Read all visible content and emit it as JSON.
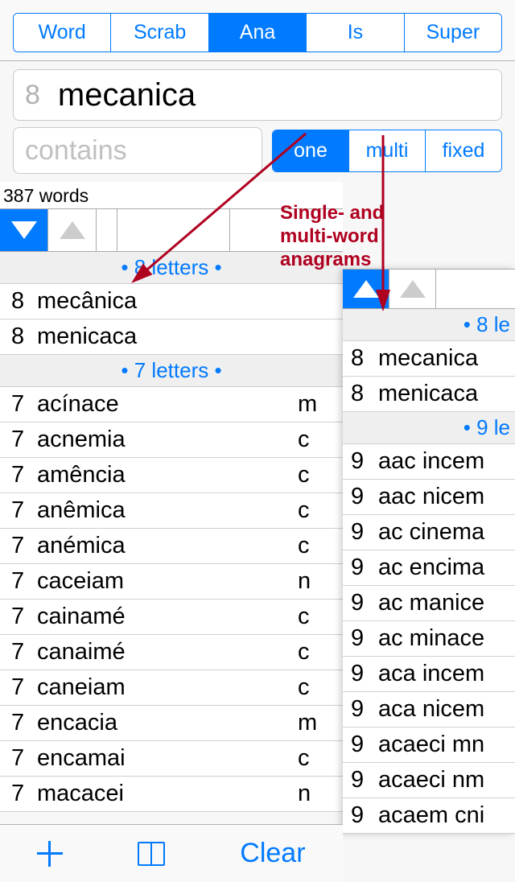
{
  "tabs": [
    "Word",
    "Scrab",
    "Ana",
    "Is",
    "Super"
  ],
  "tabs_active": 2,
  "search": {
    "count": "8",
    "term": "mecanica"
  },
  "contains_placeholder": "contains",
  "modes": [
    "one",
    "multi",
    "fixed"
  ],
  "modes_active": 0,
  "result_count_label": "387 words",
  "left": {
    "sections": [
      {
        "title": "• 8 letters •",
        "rows": [
          {
            "n": "8",
            "w": "mecânica",
            "r": ""
          },
          {
            "n": "8",
            "w": "menicaca",
            "r": ""
          }
        ]
      },
      {
        "title": "• 7 letters •",
        "rows": [
          {
            "n": "7",
            "w": "acínace",
            "r": "m"
          },
          {
            "n": "7",
            "w": "acnemia",
            "r": "c"
          },
          {
            "n": "7",
            "w": "amência",
            "r": "c"
          },
          {
            "n": "7",
            "w": "anêmica",
            "r": "c"
          },
          {
            "n": "7",
            "w": "anémica",
            "r": "c"
          },
          {
            "n": "7",
            "w": "caceiam",
            "r": "n"
          },
          {
            "n": "7",
            "w": "cainamé",
            "r": "c"
          },
          {
            "n": "7",
            "w": "canaimé",
            "r": "c"
          },
          {
            "n": "7",
            "w": "caneiam",
            "r": "c"
          },
          {
            "n": "7",
            "w": "encacia",
            "r": "m"
          },
          {
            "n": "7",
            "w": "encamai",
            "r": "c"
          },
          {
            "n": "7",
            "w": "macacei",
            "r": "n"
          }
        ]
      }
    ]
  },
  "right": {
    "sections": [
      {
        "title": "• 8 le",
        "rows": [
          {
            "n": "8",
            "w": "mecanica"
          },
          {
            "n": "8",
            "w": "menicaca"
          }
        ]
      },
      {
        "title": "• 9 le",
        "rows": [
          {
            "n": "9",
            "w": "aac incem"
          },
          {
            "n": "9",
            "w": "aac nicem"
          },
          {
            "n": "9",
            "w": "ac cinema"
          },
          {
            "n": "9",
            "w": "ac encima"
          },
          {
            "n": "9",
            "w": "ac manice"
          },
          {
            "n": "9",
            "w": "ac minace"
          },
          {
            "n": "9",
            "w": "aca incem"
          },
          {
            "n": "9",
            "w": "aca nicem"
          },
          {
            "n": "9",
            "w": "acaeci mn"
          },
          {
            "n": "9",
            "w": "acaeci nm"
          },
          {
            "n": "9",
            "w": "acaem cni"
          }
        ]
      }
    ]
  },
  "toolbar": {
    "clear": "Clear"
  },
  "annotation_text": "Single- and multi-word anagrams"
}
